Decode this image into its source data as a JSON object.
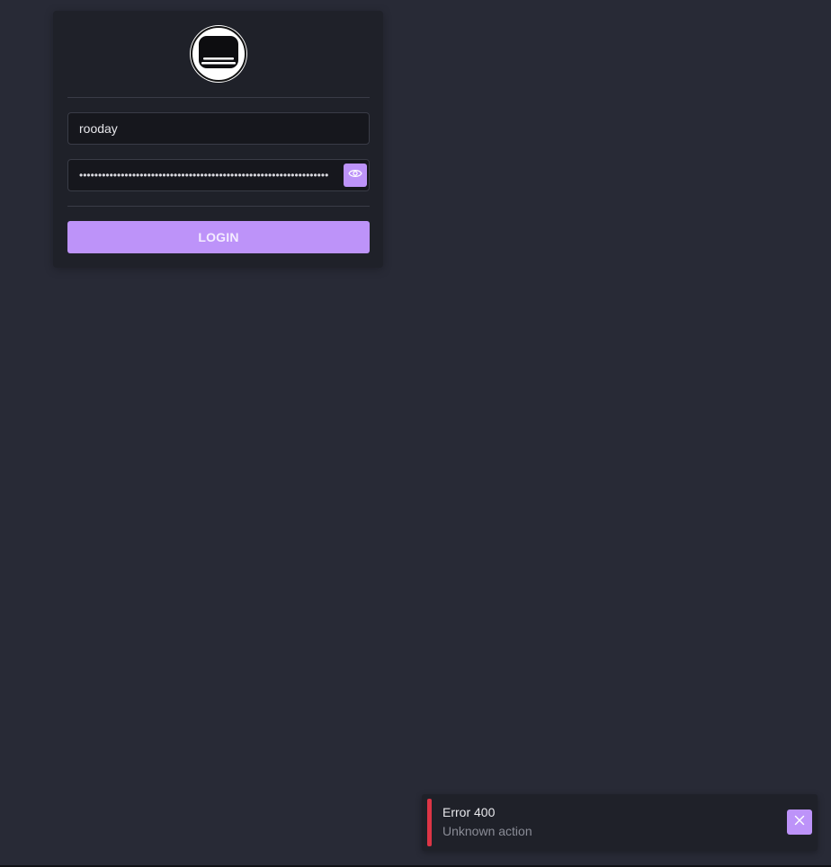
{
  "colors": {
    "background": "#282a36",
    "card": "#1f2129",
    "accent": "#bd93f9",
    "error": "#dc3545"
  },
  "login": {
    "logo_icon": "tv-icon",
    "username_value": "rooday",
    "password_value": "••••••••••••••••••••••••••••••••••••••••••••••••••••••••••••••••••",
    "show_password_icon": "eye-icon",
    "button_label": "LOGIN"
  },
  "toast": {
    "title": "Error 400",
    "message": "Unknown action",
    "close_icon": "close-icon"
  }
}
